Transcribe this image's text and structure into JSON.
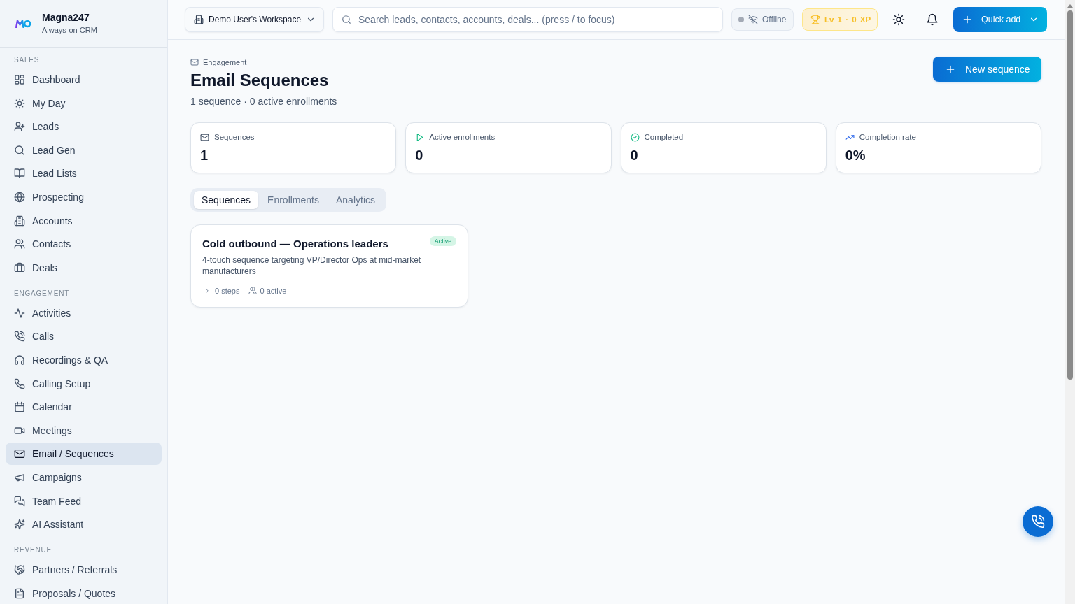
{
  "sidebar": {
    "brand": {
      "name": "Magna247",
      "tagline": "Always-on CRM"
    },
    "sections": [
      {
        "title": "SALES",
        "items": [
          {
            "label": "Dashboard",
            "selected": false
          },
          {
            "label": "My Day",
            "selected": false
          },
          {
            "label": "Leads",
            "selected": false
          },
          {
            "label": "Lead Gen",
            "selected": false
          },
          {
            "label": "Lead Lists",
            "selected": false
          },
          {
            "label": "Prospecting",
            "selected": false
          },
          {
            "label": "Accounts",
            "selected": false
          },
          {
            "label": "Contacts",
            "selected": false
          },
          {
            "label": "Deals",
            "selected": false
          }
        ]
      },
      {
        "title": "ENGAGEMENT",
        "items": [
          {
            "label": "Activities",
            "selected": false
          },
          {
            "label": "Calls",
            "selected": false
          },
          {
            "label": "Recordings & QA",
            "selected": false
          },
          {
            "label": "Calling Setup",
            "selected": false
          },
          {
            "label": "Calendar",
            "selected": false
          },
          {
            "label": "Meetings",
            "selected": false
          },
          {
            "label": "Email / Sequences",
            "selected": true
          },
          {
            "label": "Campaigns",
            "selected": false
          },
          {
            "label": "Team Feed",
            "selected": false
          },
          {
            "label": "AI Assistant",
            "selected": false
          }
        ]
      },
      {
        "title": "REVENUE",
        "items": [
          {
            "label": "Partners / Referrals",
            "selected": false
          },
          {
            "label": "Proposals / Quotes",
            "selected": false
          }
        ]
      }
    ]
  },
  "topbar": {
    "workspace": {
      "label": "Demo User's Workspace"
    },
    "search": {
      "placeholder": "Search leads, contacts, accounts, deals... (press / to focus)"
    },
    "connection": {
      "label": "Offline",
      "connected": false
    },
    "xp_badge": {
      "label": "Lv 1 · 0 XP"
    },
    "quick_add": {
      "label": "Quick add"
    }
  },
  "page": {
    "breadcrumb": "Engagement",
    "title": "Email Sequences",
    "subtitle": "1 sequence · 0 active enrollments",
    "new_button": "New sequence"
  },
  "stats": [
    {
      "label": "Sequences",
      "value": "1"
    },
    {
      "label": "Active enrollments",
      "value": "0"
    },
    {
      "label": "Completed",
      "value": "0"
    },
    {
      "label": "Completion rate",
      "value": "0%"
    }
  ],
  "tabs": [
    {
      "label": "Sequences",
      "selected": true
    },
    {
      "label": "Enrollments",
      "selected": false
    },
    {
      "label": "Analytics",
      "selected": false
    }
  ],
  "sequences": [
    {
      "name": "Cold outbound — Operations leaders",
      "status": "Active",
      "description": "4-touch sequence targeting VP/Director Ops at mid-market manufacturers",
      "steps": "0 steps",
      "enrolled": "0 active"
    }
  ]
}
